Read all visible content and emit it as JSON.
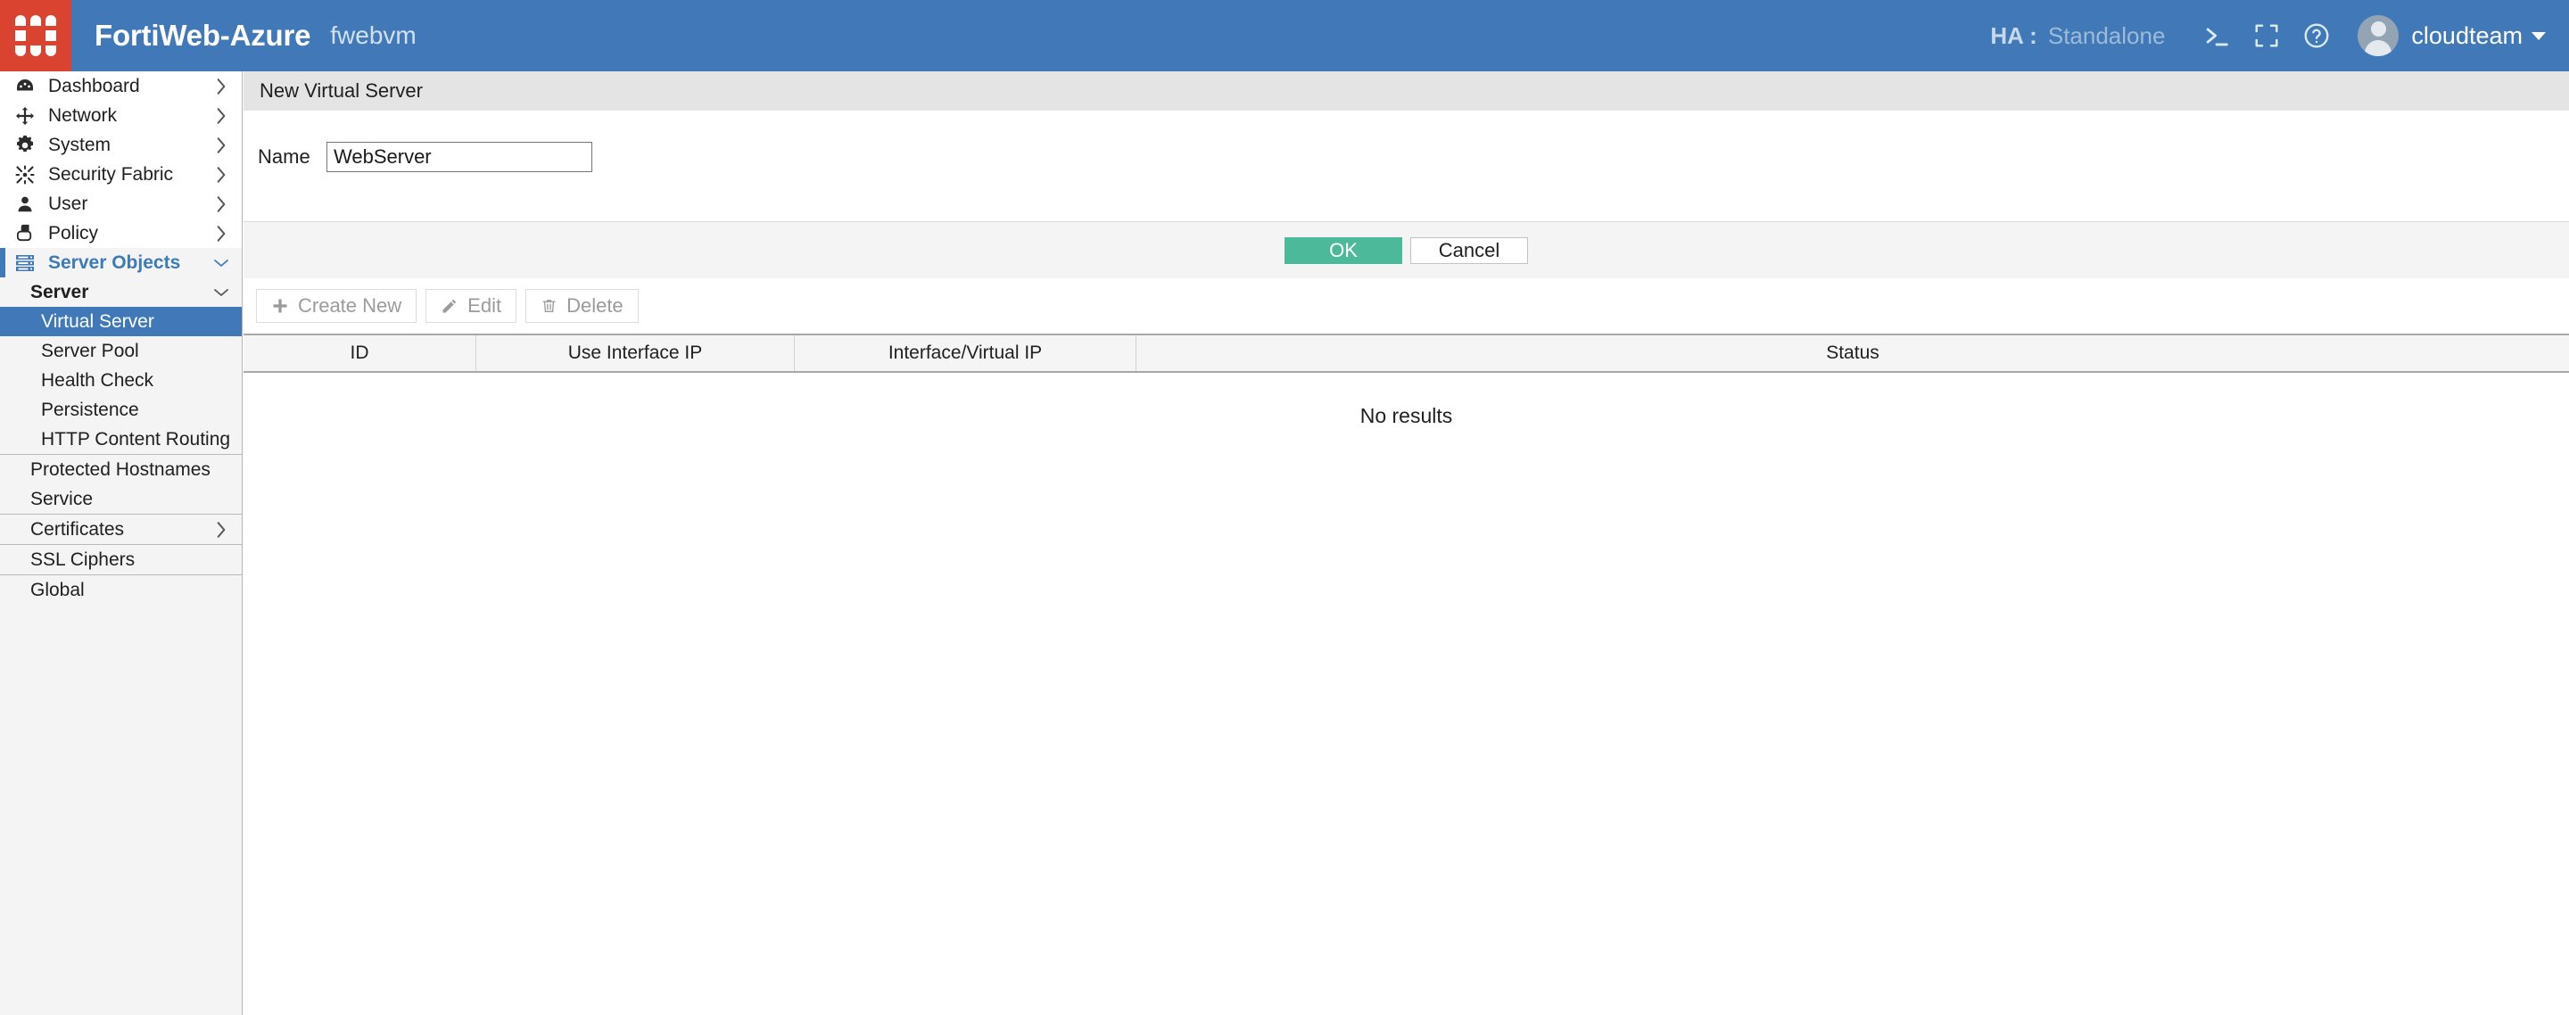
{
  "header": {
    "logo_icon": "fortinet-grid-logo",
    "brand": "FortiWeb-Azure",
    "hostname": "fwebvm",
    "ha_label": "HA :",
    "ha_value": "Standalone",
    "cli_icon": "cli-console-icon",
    "fullscreen_icon": "fullscreen-icon",
    "help_icon": "help-circle-icon",
    "avatar_icon": "user-avatar-icon",
    "username": "cloudteam",
    "caret_icon": "chevron-down-icon",
    "bg_color": "#4179b8",
    "logo_color": "#d9432f"
  },
  "sidebar": {
    "top_items": [
      {
        "label": "Dashboard",
        "icon": "dashboard-gauge-icon",
        "chevron": "chevron-right-icon"
      },
      {
        "label": "Network",
        "icon": "move-arrows-icon",
        "chevron": "chevron-right-icon"
      },
      {
        "label": "System",
        "icon": "gear-icon",
        "chevron": "chevron-right-icon"
      },
      {
        "label": "Security Fabric",
        "icon": "security-fabric-icon",
        "chevron": "chevron-right-icon"
      },
      {
        "label": "User",
        "icon": "user-icon",
        "chevron": "chevron-right-icon"
      },
      {
        "label": "Policy",
        "icon": "policy-document-icon",
        "chevron": "chevron-right-icon"
      }
    ],
    "group": {
      "label": "Server Objects",
      "icon": "server-rack-icon",
      "chevron": "chevron-down-icon",
      "accent_color": "#4179b8"
    },
    "subgroup": {
      "label": "Server",
      "chevron": "chevron-down-icon"
    },
    "server_children": [
      {
        "label": "Virtual Server",
        "selected": true
      },
      {
        "label": "Server Pool",
        "selected": false
      },
      {
        "label": "Health Check",
        "selected": false
      },
      {
        "label": "Persistence",
        "selected": false
      },
      {
        "label": "HTTP Content Routing",
        "selected": false
      }
    ],
    "flat_items_a": [
      {
        "label": "Protected Hostnames"
      },
      {
        "label": "Service"
      }
    ],
    "certificates": {
      "label": "Certificates",
      "chevron": "chevron-right-icon"
    },
    "ssl_ciphers": {
      "label": "SSL Ciphers"
    },
    "clipped_item": {
      "label": "Global"
    }
  },
  "main": {
    "panel_title": "New Virtual Server",
    "form": {
      "name_label": "Name",
      "name_value": "WebServer",
      "name_placeholder": ""
    },
    "buttons": {
      "ok": "OK",
      "ok_color": "#4cba9a",
      "cancel": "Cancel"
    },
    "toolbar": [
      {
        "label": "Create New",
        "icon": "plus-icon",
        "disabled": true
      },
      {
        "label": "Edit",
        "icon": "pencil-icon",
        "disabled": true
      },
      {
        "label": "Delete",
        "icon": "trash-icon",
        "disabled": true
      }
    ],
    "table": {
      "columns": [
        "ID",
        "Use Interface IP",
        "Interface/Virtual IP",
        "Status"
      ],
      "rows": [],
      "empty_text": "No results"
    }
  }
}
